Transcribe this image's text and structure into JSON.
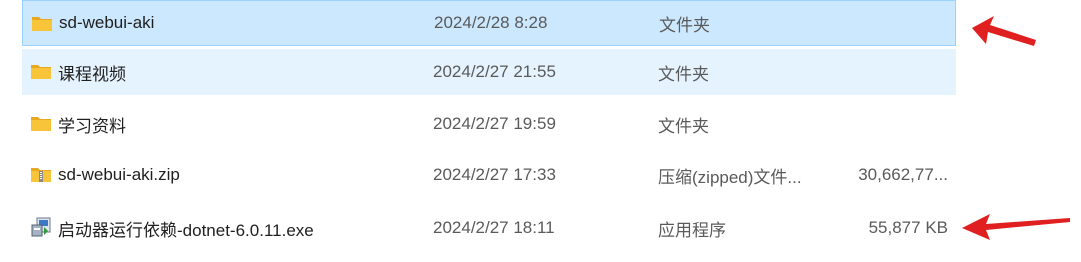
{
  "files": [
    {
      "name": "sd-webui-aki",
      "date": "2024/2/28 8:28",
      "type": "文件夹",
      "size": "",
      "icon": "folder-icon",
      "state": "selected"
    },
    {
      "name": "课程视频",
      "date": "2024/2/27 21:55",
      "type": "文件夹",
      "size": "",
      "icon": "folder-icon",
      "state": "hover"
    },
    {
      "name": "学习资料",
      "date": "2024/2/27 19:59",
      "type": "文件夹",
      "size": "",
      "icon": "folder-icon",
      "state": "normal"
    },
    {
      "name": "sd-webui-aki.zip",
      "date": "2024/2/27 17:33",
      "type": "压缩(zipped)文件...",
      "size": "30,662,77...",
      "icon": "zip-folder-icon",
      "state": "normal"
    },
    {
      "name": "启动器运行依赖-dotnet-6.0.11.exe",
      "date": "2024/2/27 18:11",
      "type": "应用程序",
      "size": "55,877 KB",
      "icon": "installer-exe-icon",
      "state": "normal"
    }
  ],
  "colors": {
    "selected_bg": "#cce8ff",
    "hover_bg": "#e5f3ff",
    "folder": "#f8c43a",
    "arrow": "#e02020"
  }
}
